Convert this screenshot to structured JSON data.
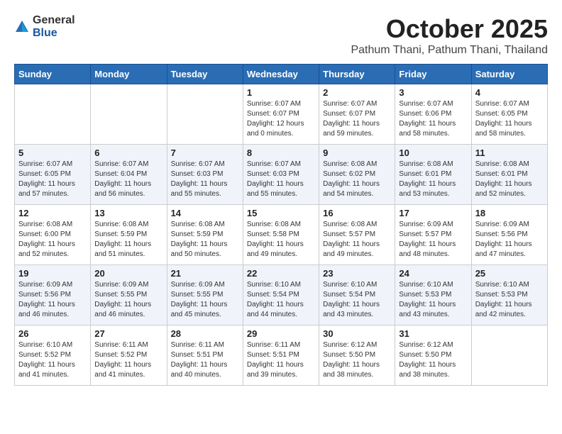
{
  "logo": {
    "general": "General",
    "blue": "Blue"
  },
  "header": {
    "month": "October 2025",
    "location": "Pathum Thani, Pathum Thani, Thailand"
  },
  "weekdays": [
    "Sunday",
    "Monday",
    "Tuesday",
    "Wednesday",
    "Thursday",
    "Friday",
    "Saturday"
  ],
  "weeks": [
    [
      {
        "day": "",
        "sunrise": "",
        "sunset": "",
        "daylight": ""
      },
      {
        "day": "",
        "sunrise": "",
        "sunset": "",
        "daylight": ""
      },
      {
        "day": "",
        "sunrise": "",
        "sunset": "",
        "daylight": ""
      },
      {
        "day": "1",
        "sunrise": "Sunrise: 6:07 AM",
        "sunset": "Sunset: 6:07 PM",
        "daylight": "Daylight: 12 hours and 0 minutes."
      },
      {
        "day": "2",
        "sunrise": "Sunrise: 6:07 AM",
        "sunset": "Sunset: 6:07 PM",
        "daylight": "Daylight: 11 hours and 59 minutes."
      },
      {
        "day": "3",
        "sunrise": "Sunrise: 6:07 AM",
        "sunset": "Sunset: 6:06 PM",
        "daylight": "Daylight: 11 hours and 58 minutes."
      },
      {
        "day": "4",
        "sunrise": "Sunrise: 6:07 AM",
        "sunset": "Sunset: 6:05 PM",
        "daylight": "Daylight: 11 hours and 58 minutes."
      }
    ],
    [
      {
        "day": "5",
        "sunrise": "Sunrise: 6:07 AM",
        "sunset": "Sunset: 6:05 PM",
        "daylight": "Daylight: 11 hours and 57 minutes."
      },
      {
        "day": "6",
        "sunrise": "Sunrise: 6:07 AM",
        "sunset": "Sunset: 6:04 PM",
        "daylight": "Daylight: 11 hours and 56 minutes."
      },
      {
        "day": "7",
        "sunrise": "Sunrise: 6:07 AM",
        "sunset": "Sunset: 6:03 PM",
        "daylight": "Daylight: 11 hours and 55 minutes."
      },
      {
        "day": "8",
        "sunrise": "Sunrise: 6:07 AM",
        "sunset": "Sunset: 6:03 PM",
        "daylight": "Daylight: 11 hours and 55 minutes."
      },
      {
        "day": "9",
        "sunrise": "Sunrise: 6:08 AM",
        "sunset": "Sunset: 6:02 PM",
        "daylight": "Daylight: 11 hours and 54 minutes."
      },
      {
        "day": "10",
        "sunrise": "Sunrise: 6:08 AM",
        "sunset": "Sunset: 6:01 PM",
        "daylight": "Daylight: 11 hours and 53 minutes."
      },
      {
        "day": "11",
        "sunrise": "Sunrise: 6:08 AM",
        "sunset": "Sunset: 6:01 PM",
        "daylight": "Daylight: 11 hours and 52 minutes."
      }
    ],
    [
      {
        "day": "12",
        "sunrise": "Sunrise: 6:08 AM",
        "sunset": "Sunset: 6:00 PM",
        "daylight": "Daylight: 11 hours and 52 minutes."
      },
      {
        "day": "13",
        "sunrise": "Sunrise: 6:08 AM",
        "sunset": "Sunset: 5:59 PM",
        "daylight": "Daylight: 11 hours and 51 minutes."
      },
      {
        "day": "14",
        "sunrise": "Sunrise: 6:08 AM",
        "sunset": "Sunset: 5:59 PM",
        "daylight": "Daylight: 11 hours and 50 minutes."
      },
      {
        "day": "15",
        "sunrise": "Sunrise: 6:08 AM",
        "sunset": "Sunset: 5:58 PM",
        "daylight": "Daylight: 11 hours and 49 minutes."
      },
      {
        "day": "16",
        "sunrise": "Sunrise: 6:08 AM",
        "sunset": "Sunset: 5:57 PM",
        "daylight": "Daylight: 11 hours and 49 minutes."
      },
      {
        "day": "17",
        "sunrise": "Sunrise: 6:09 AM",
        "sunset": "Sunset: 5:57 PM",
        "daylight": "Daylight: 11 hours and 48 minutes."
      },
      {
        "day": "18",
        "sunrise": "Sunrise: 6:09 AM",
        "sunset": "Sunset: 5:56 PM",
        "daylight": "Daylight: 11 hours and 47 minutes."
      }
    ],
    [
      {
        "day": "19",
        "sunrise": "Sunrise: 6:09 AM",
        "sunset": "Sunset: 5:56 PM",
        "daylight": "Daylight: 11 hours and 46 minutes."
      },
      {
        "day": "20",
        "sunrise": "Sunrise: 6:09 AM",
        "sunset": "Sunset: 5:55 PM",
        "daylight": "Daylight: 11 hours and 46 minutes."
      },
      {
        "day": "21",
        "sunrise": "Sunrise: 6:09 AM",
        "sunset": "Sunset: 5:55 PM",
        "daylight": "Daylight: 11 hours and 45 minutes."
      },
      {
        "day": "22",
        "sunrise": "Sunrise: 6:10 AM",
        "sunset": "Sunset: 5:54 PM",
        "daylight": "Daylight: 11 hours and 44 minutes."
      },
      {
        "day": "23",
        "sunrise": "Sunrise: 6:10 AM",
        "sunset": "Sunset: 5:54 PM",
        "daylight": "Daylight: 11 hours and 43 minutes."
      },
      {
        "day": "24",
        "sunrise": "Sunrise: 6:10 AM",
        "sunset": "Sunset: 5:53 PM",
        "daylight": "Daylight: 11 hours and 43 minutes."
      },
      {
        "day": "25",
        "sunrise": "Sunrise: 6:10 AM",
        "sunset": "Sunset: 5:53 PM",
        "daylight": "Daylight: 11 hours and 42 minutes."
      }
    ],
    [
      {
        "day": "26",
        "sunrise": "Sunrise: 6:10 AM",
        "sunset": "Sunset: 5:52 PM",
        "daylight": "Daylight: 11 hours and 41 minutes."
      },
      {
        "day": "27",
        "sunrise": "Sunrise: 6:11 AM",
        "sunset": "Sunset: 5:52 PM",
        "daylight": "Daylight: 11 hours and 41 minutes."
      },
      {
        "day": "28",
        "sunrise": "Sunrise: 6:11 AM",
        "sunset": "Sunset: 5:51 PM",
        "daylight": "Daylight: 11 hours and 40 minutes."
      },
      {
        "day": "29",
        "sunrise": "Sunrise: 6:11 AM",
        "sunset": "Sunset: 5:51 PM",
        "daylight": "Daylight: 11 hours and 39 minutes."
      },
      {
        "day": "30",
        "sunrise": "Sunrise: 6:12 AM",
        "sunset": "Sunset: 5:50 PM",
        "daylight": "Daylight: 11 hours and 38 minutes."
      },
      {
        "day": "31",
        "sunrise": "Sunrise: 6:12 AM",
        "sunset": "Sunset: 5:50 PM",
        "daylight": "Daylight: 11 hours and 38 minutes."
      },
      {
        "day": "",
        "sunrise": "",
        "sunset": "",
        "daylight": ""
      }
    ]
  ]
}
